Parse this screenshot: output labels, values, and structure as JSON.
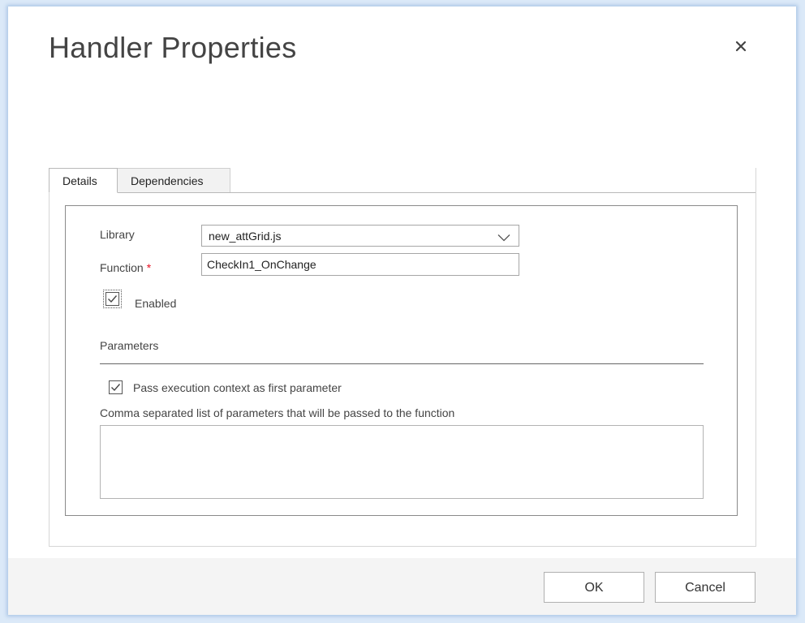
{
  "dialog": {
    "title": "Handler Properties",
    "close_icon": "close-icon"
  },
  "tabs": [
    {
      "label": "Details",
      "active": true
    },
    {
      "label": "Dependencies",
      "active": false
    }
  ],
  "details": {
    "library_label": "Library",
    "library_value": "new_attGrid.js",
    "function_label": "Function",
    "required_marker": "*",
    "function_value": "CheckIn1_OnChange",
    "enabled_label": "Enabled",
    "enabled_checked": true,
    "parameters_heading": "Parameters",
    "pass_context_label": "Pass execution context as first parameter",
    "pass_context_checked": true,
    "param_list_label": "Comma separated list of parameters that will be passed to the function",
    "param_list_value": ""
  },
  "footer": {
    "ok_label": "OK",
    "cancel_label": "Cancel"
  },
  "colors": {
    "required": "#e81123",
    "frame_glow": "#dbe9f8",
    "footer_bg": "#f4f4f4"
  }
}
